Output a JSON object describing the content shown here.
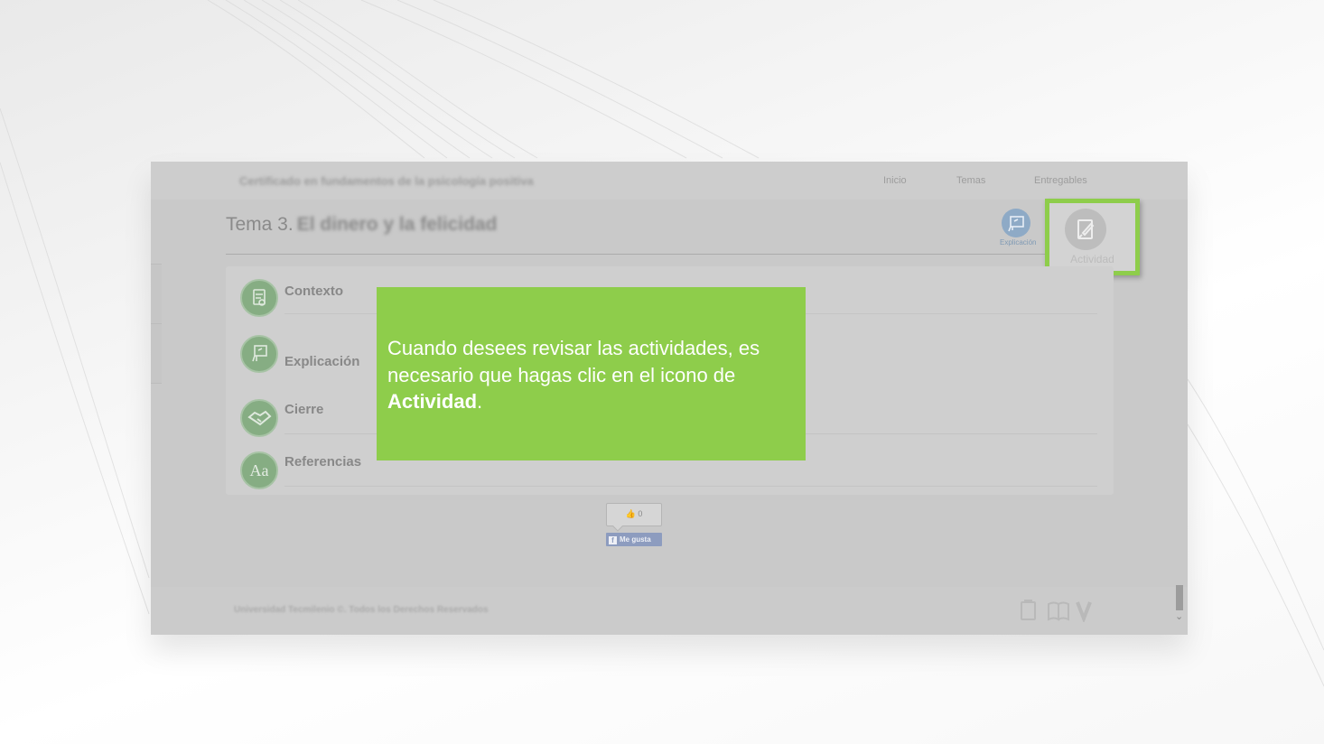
{
  "course": {
    "title": "Certificado en fundamentos de la psicología positiva"
  },
  "nav": {
    "items": [
      "Inicio",
      "Temas",
      "Entregables"
    ]
  },
  "topic": {
    "number": "Tema 3.",
    "name": "El dinero y la felicidad"
  },
  "toolbar": {
    "explicacion_label": "Explicación",
    "actividad_label": "Actividad"
  },
  "menu": {
    "items": [
      {
        "label": "Contexto",
        "icon": "document-icon"
      },
      {
        "label": "Explicación",
        "icon": "presentation-icon"
      },
      {
        "label": "Cierre",
        "icon": "handshake-icon"
      },
      {
        "label": "Referencias",
        "icon": "aa-icon",
        "glyph": "Aa"
      }
    ]
  },
  "social": {
    "like_count": "0",
    "like_button": "Me gusta"
  },
  "footer": {
    "text": "Universidad Tecmilenio ©. Todos los Derechos Reservados"
  },
  "tip": {
    "text_before": "Cuando desees revisar las actividades, es necesario que hagas clic en el icono de ",
    "text_strong": "Actividad",
    "text_after": "."
  },
  "colors": {
    "highlight_green": "#8ecd4b",
    "menu_icon_green": "#86ad83",
    "facebook_blue": "#8d9cbf"
  }
}
